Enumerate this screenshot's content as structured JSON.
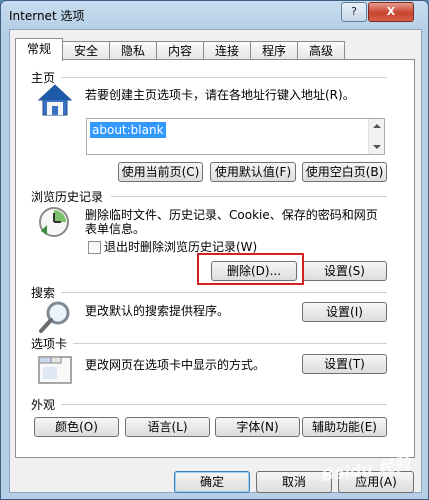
{
  "window": {
    "title": "Internet 选项",
    "help_label": "?",
    "close_label": "X"
  },
  "tabs": [
    {
      "label": "常规"
    },
    {
      "label": "安全"
    },
    {
      "label": "隐私"
    },
    {
      "label": "内容"
    },
    {
      "label": "连接"
    },
    {
      "label": "程序"
    },
    {
      "label": "高级"
    }
  ],
  "home": {
    "title": "主页",
    "description": "若要创建主页选项卡，请在各地址行键入地址(R)。",
    "url_value": "about:blank",
    "buttons": [
      "使用当前页(C)",
      "使用默认值(F)",
      "使用空白页(B)"
    ]
  },
  "history": {
    "title": "浏览历史记录",
    "description_line1": "删除临时文件、历史记录、Cookie、保存的密码和网页",
    "description_line2": "表单信息。",
    "checkbox_label": "退出时删除浏览历史记录(W)",
    "checkbox_checked": false,
    "delete_label": "删除(D)...",
    "settings_label": "设置(S)"
  },
  "search": {
    "title": "搜索",
    "description": "更改默认的搜索提供程序。",
    "settings_label": "设置(I)"
  },
  "tabs_section": {
    "title": "选项卡",
    "description": "更改网页在选项卡中显示的方式。",
    "settings_label": "设置(T)"
  },
  "appearance": {
    "title": "外观",
    "buttons": [
      "颜色(O)",
      "语言(L)",
      "字体(N)",
      "辅助功能(E)"
    ]
  },
  "footer": {
    "ok_label": "确定",
    "cancel_label": "取消",
    "apply_label": "应用(A)"
  },
  "watermark": "Baidu 经验",
  "colors": {
    "highlight": "#3399ff",
    "annotation_red": "#d42020"
  }
}
